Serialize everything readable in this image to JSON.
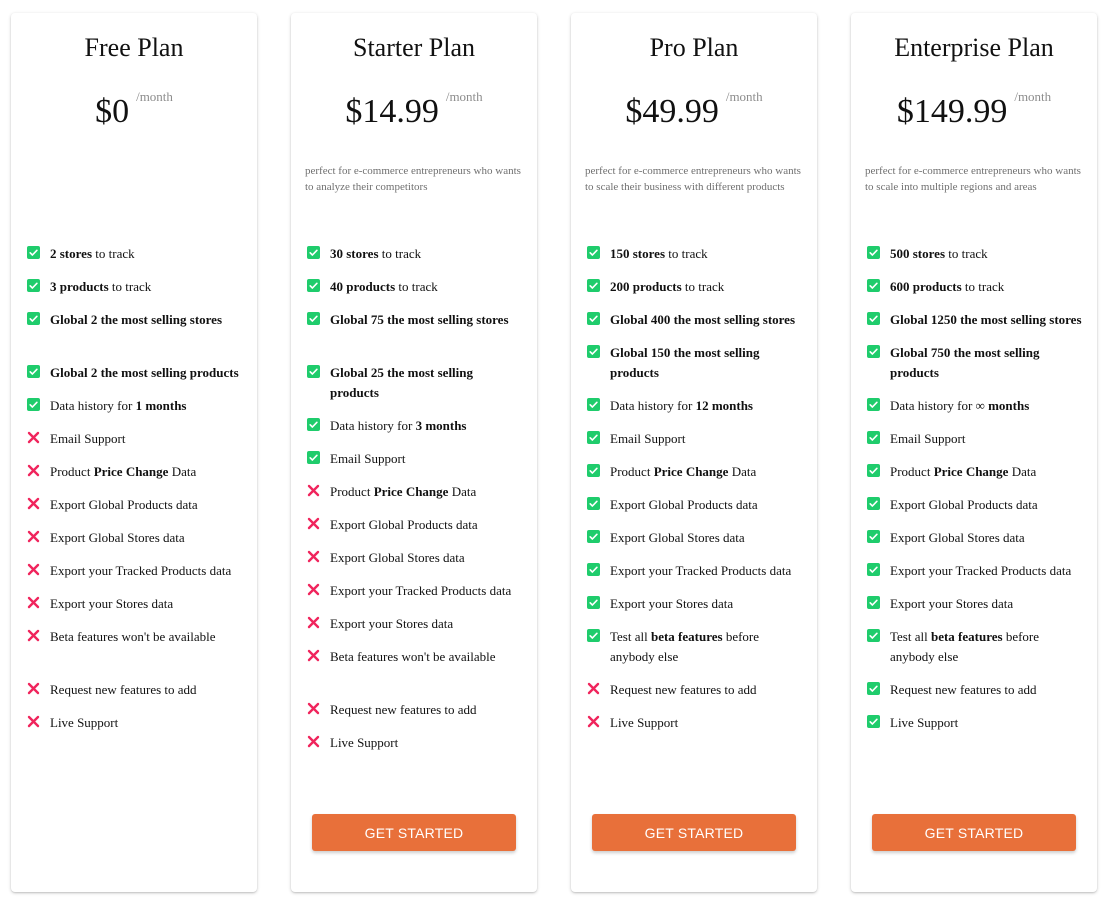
{
  "theme": {
    "accent": "#e8703a",
    "check_color": "#1fcc6c",
    "cross_color": "#f0245c"
  },
  "plans": [
    {
      "id": "free",
      "title": "Free Plan",
      "price": "$0",
      "period": "/month",
      "description": "",
      "button_label": "",
      "features": [
        {
          "included": true,
          "parts": [
            {
              "b": "2 stores"
            },
            {
              "t": " to track"
            }
          ]
        },
        {
          "included": true,
          "parts": [
            {
              "b": "3 products"
            },
            {
              "t": " to track"
            }
          ]
        },
        {
          "included": true,
          "spacer": true,
          "parts": [
            {
              "b": "Global 2 the most selling stores"
            }
          ]
        },
        {
          "included": true,
          "parts": [
            {
              "b": "Global 2 the most selling products"
            }
          ]
        },
        {
          "included": true,
          "parts": [
            {
              "t": "Data history for "
            },
            {
              "b": "1 months"
            }
          ]
        },
        {
          "included": false,
          "parts": [
            {
              "t": "Email Support"
            }
          ]
        },
        {
          "included": false,
          "parts": [
            {
              "t": "Product "
            },
            {
              "b": "Price Change"
            },
            {
              "t": " Data"
            }
          ]
        },
        {
          "included": false,
          "parts": [
            {
              "t": "Export Global Products data"
            }
          ]
        },
        {
          "included": false,
          "parts": [
            {
              "t": "Export Global Stores data"
            }
          ]
        },
        {
          "included": false,
          "parts": [
            {
              "t": "Export your Tracked Products data"
            }
          ]
        },
        {
          "included": false,
          "parts": [
            {
              "t": "Export your Stores data"
            }
          ]
        },
        {
          "included": false,
          "spacer": true,
          "parts": [
            {
              "t": "Beta features won't be available"
            }
          ]
        },
        {
          "included": false,
          "parts": [
            {
              "t": "Request new features to add"
            }
          ]
        },
        {
          "included": false,
          "parts": [
            {
              "t": "Live Support"
            }
          ]
        }
      ]
    },
    {
      "id": "starter",
      "title": "Starter Plan",
      "price": "$14.99",
      "period": "/month",
      "description": "perfect for e-commerce entrepreneurs who wants to analyze their competitors",
      "button_label": "GET STARTED",
      "features": [
        {
          "included": true,
          "parts": [
            {
              "b": "30 stores"
            },
            {
              "t": " to track"
            }
          ]
        },
        {
          "included": true,
          "parts": [
            {
              "b": "40 products"
            },
            {
              "t": " to track"
            }
          ]
        },
        {
          "included": true,
          "spacer": true,
          "parts": [
            {
              "b": "Global 75 the most selling stores"
            }
          ]
        },
        {
          "included": true,
          "parts": [
            {
              "b": "Global 25 the most selling products"
            }
          ]
        },
        {
          "included": true,
          "parts": [
            {
              "t": "Data history for "
            },
            {
              "b": "3 months"
            }
          ]
        },
        {
          "included": true,
          "parts": [
            {
              "t": "Email Support"
            }
          ]
        },
        {
          "included": false,
          "parts": [
            {
              "t": "Product "
            },
            {
              "b": "Price Change"
            },
            {
              "t": " Data"
            }
          ]
        },
        {
          "included": false,
          "parts": [
            {
              "t": "Export Global Products data"
            }
          ]
        },
        {
          "included": false,
          "parts": [
            {
              "t": "Export Global Stores data"
            }
          ]
        },
        {
          "included": false,
          "parts": [
            {
              "t": "Export your Tracked Products data"
            }
          ]
        },
        {
          "included": false,
          "parts": [
            {
              "t": "Export your Stores data"
            }
          ]
        },
        {
          "included": false,
          "spacer": true,
          "parts": [
            {
              "t": "Beta features won't be available"
            }
          ]
        },
        {
          "included": false,
          "parts": [
            {
              "t": "Request new features to add"
            }
          ]
        },
        {
          "included": false,
          "parts": [
            {
              "t": "Live Support"
            }
          ]
        }
      ]
    },
    {
      "id": "pro",
      "title": "Pro Plan",
      "price": "$49.99",
      "period": "/month",
      "description": "perfect for e-commerce entrepreneurs who wants to scale their business with different products",
      "button_label": "GET STARTED",
      "features": [
        {
          "included": true,
          "parts": [
            {
              "b": "150 stores"
            },
            {
              "t": " to track"
            }
          ]
        },
        {
          "included": true,
          "parts": [
            {
              "b": "200 products"
            },
            {
              "t": " to track"
            }
          ]
        },
        {
          "included": true,
          "parts": [
            {
              "b": "Global 400 the most selling stores"
            }
          ]
        },
        {
          "included": true,
          "parts": [
            {
              "b": "Global 150 the most selling products"
            }
          ]
        },
        {
          "included": true,
          "parts": [
            {
              "t": "Data history for "
            },
            {
              "b": "12 months"
            }
          ]
        },
        {
          "included": true,
          "parts": [
            {
              "t": "Email Support"
            }
          ]
        },
        {
          "included": true,
          "parts": [
            {
              "t": "Product "
            },
            {
              "b": "Price Change"
            },
            {
              "t": " Data"
            }
          ]
        },
        {
          "included": true,
          "parts": [
            {
              "t": "Export Global Products data"
            }
          ]
        },
        {
          "included": true,
          "parts": [
            {
              "t": "Export Global Stores data"
            }
          ]
        },
        {
          "included": true,
          "parts": [
            {
              "t": "Export your Tracked Products data"
            }
          ]
        },
        {
          "included": true,
          "parts": [
            {
              "t": "Export your Stores data"
            }
          ]
        },
        {
          "included": true,
          "parts": [
            {
              "t": "Test all "
            },
            {
              "b": "beta features"
            },
            {
              "t": " before anybody else"
            }
          ]
        },
        {
          "included": false,
          "parts": [
            {
              "t": "Request new features to add"
            }
          ]
        },
        {
          "included": false,
          "parts": [
            {
              "t": "Live Support"
            }
          ]
        }
      ]
    },
    {
      "id": "enterprise",
      "title": "Enterprise Plan",
      "price": "$149.99",
      "period": "/month",
      "description": "perfect for e-commerce entrepreneurs who wants to scale into multiple regions and areas",
      "button_label": "GET STARTED",
      "features": [
        {
          "included": true,
          "parts": [
            {
              "b": "500 stores"
            },
            {
              "t": " to track"
            }
          ]
        },
        {
          "included": true,
          "parts": [
            {
              "b": "600 products"
            },
            {
              "t": " to track"
            }
          ]
        },
        {
          "included": true,
          "parts": [
            {
              "b": "Global 1250 the most selling stores"
            }
          ]
        },
        {
          "included": true,
          "parts": [
            {
              "b": "Global 750 the most selling products"
            }
          ]
        },
        {
          "included": true,
          "parts": [
            {
              "t": "Data history for ∞ "
            },
            {
              "b": "months"
            }
          ]
        },
        {
          "included": true,
          "parts": [
            {
              "t": "Email Support"
            }
          ]
        },
        {
          "included": true,
          "parts": [
            {
              "t": "Product "
            },
            {
              "b": "Price Change"
            },
            {
              "t": " Data"
            }
          ]
        },
        {
          "included": true,
          "parts": [
            {
              "t": "Export Global Products data"
            }
          ]
        },
        {
          "included": true,
          "parts": [
            {
              "t": "Export Global Stores data"
            }
          ]
        },
        {
          "included": true,
          "parts": [
            {
              "t": "Export your Tracked Products data"
            }
          ]
        },
        {
          "included": true,
          "parts": [
            {
              "t": "Export your Stores data"
            }
          ]
        },
        {
          "included": true,
          "parts": [
            {
              "t": "Test all "
            },
            {
              "b": "beta features"
            },
            {
              "t": " before anybody else"
            }
          ]
        },
        {
          "included": true,
          "parts": [
            {
              "t": "Request new features to add"
            }
          ]
        },
        {
          "included": true,
          "parts": [
            {
              "t": "Live Support"
            }
          ]
        }
      ]
    }
  ]
}
